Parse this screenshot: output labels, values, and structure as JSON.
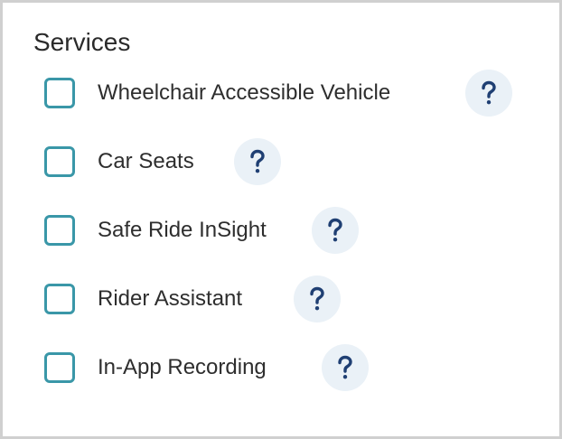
{
  "section": {
    "title": "Services"
  },
  "services": [
    {
      "label": "Wheelchair Accessible Vehicle",
      "checked": false,
      "help_icon": "question-mark-icon"
    },
    {
      "label": "Car Seats",
      "checked": false,
      "help_icon": "question-mark-icon"
    },
    {
      "label": "Safe Ride InSight",
      "checked": false,
      "help_icon": "question-mark-icon"
    },
    {
      "label": "Rider Assistant",
      "checked": false,
      "help_icon": "question-mark-icon"
    },
    {
      "label": "In-App Recording",
      "checked": false,
      "help_icon": "question-mark-icon"
    }
  ],
  "colors": {
    "checkbox_border": "#3a97a8",
    "help_bg": "#eaf1f7",
    "help_icon": "#1f3f73",
    "panel_border": "#d0d0d0"
  }
}
